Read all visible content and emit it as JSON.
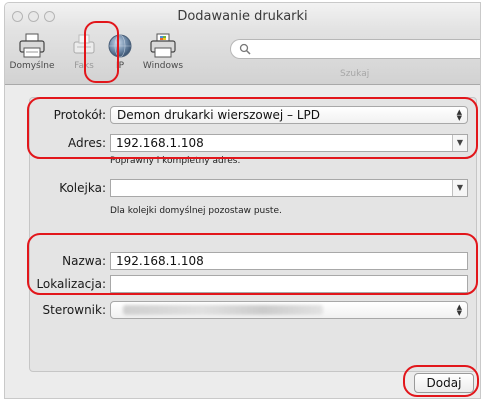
{
  "window": {
    "title": "Dodawanie drukarki"
  },
  "toolbar": {
    "items": [
      {
        "label": "Domyślne",
        "icon": "printer-icon"
      },
      {
        "label": "Faks",
        "icon": "fax-icon"
      },
      {
        "label": "IP",
        "icon": "globe-icon",
        "selected": true
      },
      {
        "label": "Windows",
        "icon": "windows-printer-icon"
      }
    ],
    "search": {
      "label": "Szukaj",
      "value": ""
    }
  },
  "form": {
    "protocol_label": "Protokół:",
    "protocol_value": "Demon drukarki wierszowej – LPD",
    "address_label": "Adres:",
    "address_value": "192.168.1.108",
    "address_hint": "Poprawny i kompletny adres.",
    "queue_label": "Kolejka:",
    "queue_value": "",
    "queue_hint": "Dla kolejki domyślnej pozostaw puste.",
    "name_label": "Nazwa:",
    "name_value": "192.168.1.108",
    "location_label": "Lokalizacja:",
    "location_value": "",
    "driver_label": "Sterownik:"
  },
  "buttons": {
    "add_label": "Dodaj"
  },
  "colors": {
    "highlight": "#e2161b",
    "background": "#ececec"
  }
}
